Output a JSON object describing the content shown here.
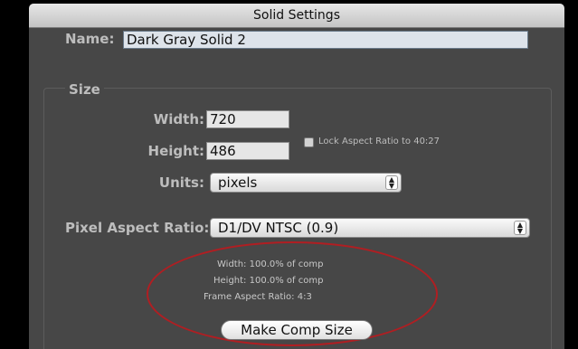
{
  "dialog": {
    "title": "Solid Settings"
  },
  "name": {
    "label": "Name:",
    "value": "Dark Gray Solid 2"
  },
  "size": {
    "group_title": "Size",
    "width_label": "Width:",
    "width_value": "720",
    "height_label": "Height:",
    "height_value": "486",
    "lock_label": "Lock Aspect Ratio to 40:27",
    "lock_checked": false,
    "units_label": "Units:",
    "units_value": "pixels"
  },
  "pixel_aspect": {
    "label": "Pixel Aspect Ratio:",
    "value": "D1/DV NTSC (0.9)"
  },
  "info": {
    "width_line": "Width:  100.0% of comp",
    "height_line": "Height:  100.0% of comp",
    "frame_line": "Frame Aspect Ratio: 4:3"
  },
  "buttons": {
    "make_comp_size": "Make Comp Size"
  },
  "colors": {
    "panel": "#474747",
    "highlight_ellipse": "#b01e22"
  }
}
